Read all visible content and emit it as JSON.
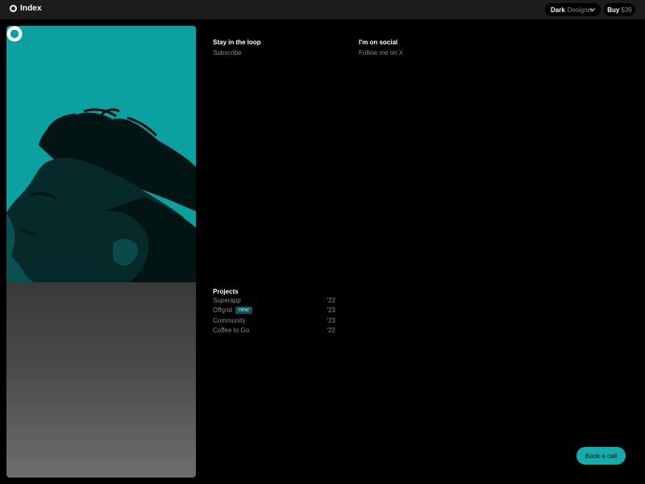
{
  "header": {
    "brand": "Index",
    "theme": {
      "mode": "Dark",
      "variant": "Designer"
    },
    "buy": {
      "label": "Buy",
      "price": "$39"
    }
  },
  "colors": {
    "accent": "#12adad",
    "photo_bg": "#0ba1a1",
    "badge_bg": "#0b5757",
    "muted": "#8a8a8a"
  },
  "newsletter": {
    "title": "Stay in the loop",
    "link": "Subscribe"
  },
  "social": {
    "title": "I'm on social",
    "link": "Follow me on X"
  },
  "projects": {
    "title": "Projects",
    "items": [
      {
        "name": "Superapp",
        "year": "'22",
        "badge": ""
      },
      {
        "name": "Offgrid",
        "year": "'23",
        "badge": "new"
      },
      {
        "name": "Community",
        "year": "'23",
        "badge": ""
      },
      {
        "name": "Coffee to Go",
        "year": "'22",
        "badge": ""
      }
    ]
  },
  "cta": {
    "label": "Book a call"
  },
  "icons": {
    "brand": "ring-logo-icon",
    "photo_logo": "flower-logo-icon",
    "theme": "chevron-down-icon"
  }
}
